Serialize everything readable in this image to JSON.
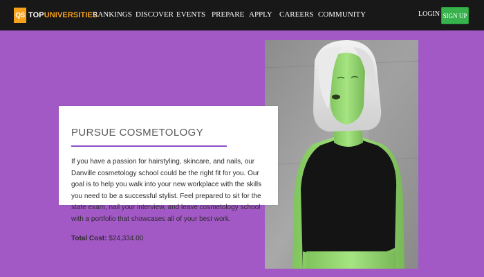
{
  "header": {
    "logo_badge": "QS",
    "logo_text_primary": "TOP",
    "logo_text_accent": "UNIVERSITIES",
    "nav": [
      "RANKINGS",
      "DISCOVER",
      "EVENTS",
      "PREPARE",
      "APPLY",
      "CAREERS",
      "COMMUNITY"
    ],
    "login_label": "LOGIN",
    "signup_label": "SIGN UP"
  },
  "hero": {
    "title": "PURSUE COSMETOLOGY",
    "body": "If you have a passion for hairstyling, skincare, and nails, our Danville cosmetology school could be the right fit for you. Our goal is to help you walk into your new workplace with the skills you need to be a successful stylist. Feel prepared to sit for the state exam, nail your interview, and leave cosmetology school with a portfolio that showcases all of your best work.",
    "cost_label": "Total Cost:",
    "cost_value": "$24,334.00"
  },
  "colors": {
    "page_background": "#a259c6",
    "navbar_background": "#181818",
    "logo_accent": "#f7a21b",
    "signup_button": "#37b24d",
    "title_rule": "#8e50c8",
    "photo_tint": "#9fe07a"
  },
  "icons": {
    "logo": "qs-logo-icon",
    "hero_image": "model-portrait-image"
  }
}
